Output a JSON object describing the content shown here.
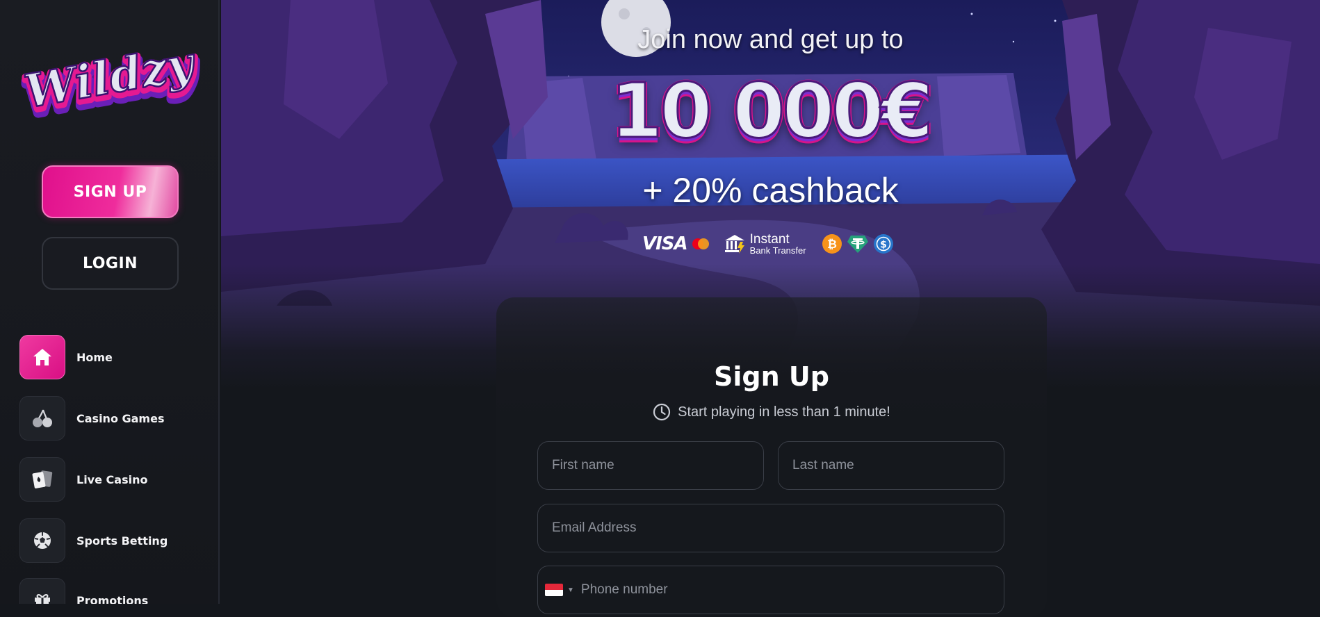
{
  "brand": {
    "name": "Wildzy"
  },
  "sidebar": {
    "signup_label": "SIGN UP",
    "login_label": "LOGIN",
    "nav": [
      {
        "label": "Home",
        "icon": "home-icon",
        "active": true
      },
      {
        "label": "Casino Games",
        "icon": "cherries-icon"
      },
      {
        "label": "Live Casino",
        "icon": "cards-icon"
      },
      {
        "label": "Sports Betting",
        "icon": "soccer-ball-icon"
      },
      {
        "label": "Promotions",
        "icon": "gift-icon"
      }
    ]
  },
  "hero": {
    "line1": "Join now and get up to",
    "amount": "10 000€",
    "cashback": "+ 20% cashback",
    "payments": {
      "visa": "VISA",
      "bank_line1": "Instant",
      "bank_line2": "Bank Transfer",
      "coins": [
        "bitcoin-icon",
        "tether-icon",
        "usdc-icon"
      ]
    }
  },
  "signup_form": {
    "title": "Sign Up",
    "subtitle": "Start playing in less than 1 minute!",
    "first_name_placeholder": "First name",
    "last_name_placeholder": "Last name",
    "email_placeholder": "Email Address",
    "phone_placeholder": "Phone number"
  },
  "colors": {
    "accent": "#e0108c",
    "background": "#14171c",
    "sidebar": "#1a1c22"
  }
}
